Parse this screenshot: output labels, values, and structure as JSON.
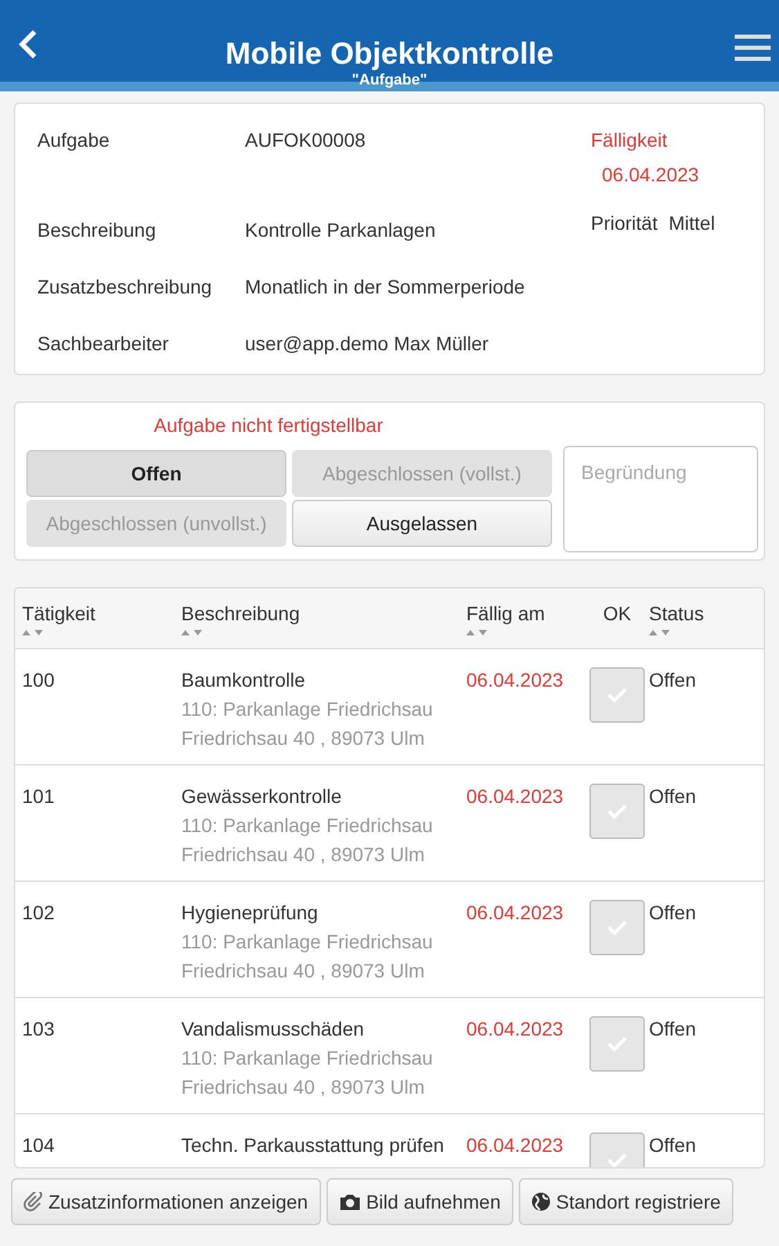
{
  "header": {
    "title": "Mobile Objektkontrolle",
    "subtitle": "\"Aufgabe\""
  },
  "task": {
    "fields": [
      {
        "label": "Aufgabe",
        "value": "AUFOK00008"
      },
      {
        "label": "Beschreibung",
        "value": "Kontrolle Parkanlagen"
      },
      {
        "label": "Zusatzbeschreibung",
        "value": "Monatlich in der Sommerperiode"
      },
      {
        "label": "Sachbearbeiter",
        "value": "user@app.demo Max Müller"
      }
    ],
    "due_label": "Fälligkeit",
    "due_date": "06.04.2023",
    "priority_label": "Priorität",
    "priority": "Mittel"
  },
  "status": {
    "warning": "Aufgabe nicht fertigstellbar",
    "buttons": [
      {
        "label": "Offen",
        "selected": true,
        "disabled": false
      },
      {
        "label": "Abgeschlossen (vollst.)",
        "selected": false,
        "disabled": true
      },
      {
        "label": "Abgeschlossen (unvollst.)",
        "selected": false,
        "disabled": true
      },
      {
        "label": "Ausgelassen",
        "selected": false,
        "disabled": false
      }
    ],
    "reason": {
      "placeholder": "Begründung"
    }
  },
  "table": {
    "columns": [
      {
        "label": "Tätigkeit",
        "sortable": true
      },
      {
        "label": "Beschreibung",
        "sortable": true
      },
      {
        "label": "Fällig am",
        "sortable": true
      },
      {
        "label": "OK",
        "sortable": false
      },
      {
        "label": "Status",
        "sortable": true
      }
    ],
    "rows": [
      {
        "id": "100",
        "title": "Baumkontrolle",
        "details": [
          "110: Parkanlage Friedrichsau",
          "Friedrichsau 40 , 89073 Ulm"
        ],
        "due": "06.04.2023",
        "checked": false,
        "status": "Offen"
      },
      {
        "id": "101",
        "title": "Gewässerkontrolle",
        "details": [
          "110: Parkanlage Friedrichsau",
          "Friedrichsau 40 , 89073 Ulm"
        ],
        "due": "06.04.2023",
        "checked": false,
        "status": "Offen"
      },
      {
        "id": "102",
        "title": "Hygieneprüfung",
        "details": [
          "110: Parkanlage Friedrichsau",
          "Friedrichsau 40 , 89073 Ulm"
        ],
        "due": "06.04.2023",
        "checked": false,
        "status": "Offen"
      },
      {
        "id": "103",
        "title": "Vandalismusschäden",
        "details": [
          "110: Parkanlage Friedrichsau",
          "Friedrichsau 40 , 89073 Ulm"
        ],
        "due": "06.04.2023",
        "checked": false,
        "status": "Offen"
      },
      {
        "id": "104",
        "title": "Techn. Parkausstattung prüfen",
        "details": [],
        "due": "06.04.2023",
        "checked": false,
        "status": "Offen"
      }
    ]
  },
  "footer": {
    "buttons": [
      {
        "label": "Zusatzinformationen anzeigen"
      },
      {
        "label": "Bild aufnehmen"
      },
      {
        "label": "Standort registriere"
      }
    ]
  }
}
